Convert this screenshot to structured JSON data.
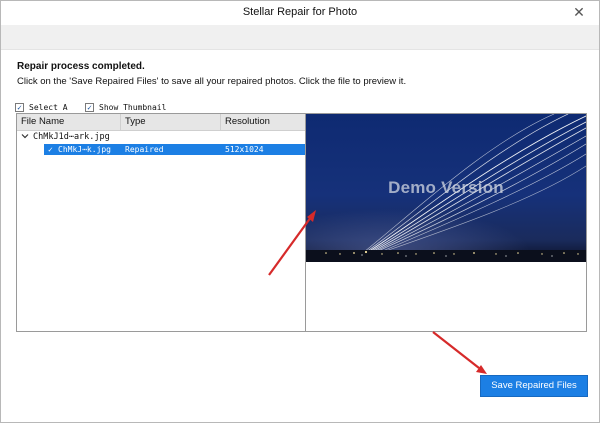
{
  "window": {
    "title": "Stellar Repair for Photo",
    "close_glyph": "✕"
  },
  "message": {
    "title": "Repair process completed.",
    "body": "Click on the 'Save Repaired Files' to save all your repaired photos. Click the file to preview it."
  },
  "options": {
    "select_all_label": "Select A",
    "show_thumbnail_label": "Show Thumbnail",
    "select_all_checked": true,
    "show_thumbnail_checked": true
  },
  "file_list": {
    "columns": [
      "File Name",
      "Type",
      "Resolution"
    ],
    "parent": {
      "name": "ChMkJ1d⋯ark.jpg",
      "expanded": true
    },
    "rows": [
      {
        "checked": true,
        "name": "ChMkJ⋯k.jpg",
        "type": "Repaired",
        "resolution": "512x1024",
        "selected": true
      }
    ]
  },
  "preview": {
    "watermark": "Demo Version",
    "image_subject": "night-sky-airport-long-exposure"
  },
  "actions": {
    "save_label": "Save Repaired Files"
  },
  "colors": {
    "accent": "#1c7fe4",
    "annotation_arrow": "#d62a2a"
  },
  "icons": {
    "close": "close-icon",
    "tree_toggle": "chevron-down-icon",
    "checkbox": "checkbox-checked-icon"
  }
}
